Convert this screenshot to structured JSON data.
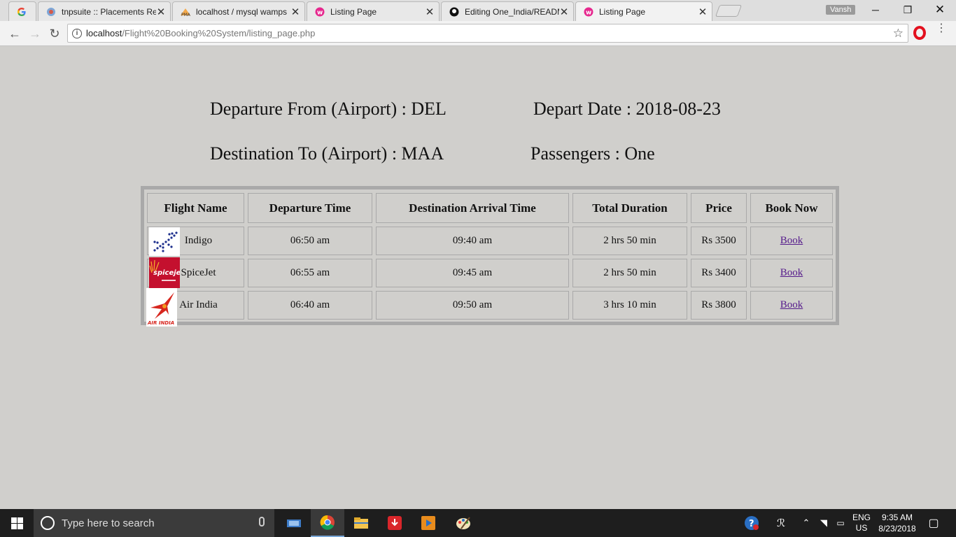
{
  "browser": {
    "tabs": [
      {
        "title": "",
        "icon": "google-icon",
        "active": false
      },
      {
        "title": "tnpsuite :: Placements Re",
        "icon": "tnpsuite-icon",
        "active": false
      },
      {
        "title": "localhost / mysql wamps",
        "icon": "phpmyadmin-icon",
        "active": false
      },
      {
        "title": "Listing Page",
        "icon": "wamp-icon",
        "active": false
      },
      {
        "title": "Editing One_India/READM",
        "icon": "github-icon",
        "active": false
      },
      {
        "title": "Listing Page",
        "icon": "wamp-icon",
        "active": true
      }
    ],
    "profile_name": "Vansh",
    "url_host": "localhost",
    "url_path": "/Flight%20Booking%20System/listing_page.php"
  },
  "search": {
    "departure_line": "Departure From (Airport) : DEL",
    "depart_date_line": "Depart Date : 2018-08-23",
    "destination_line": "Destination To (Airport) : MAA",
    "passengers_line": "Passengers : One"
  },
  "table": {
    "headers": [
      "Flight Name",
      "Departure Time",
      "Destination Arrival Time",
      "Total Duration",
      "Price",
      "Book Now"
    ],
    "rows": [
      {
        "name": "Indigo",
        "logo": "indigo-logo",
        "departure": "06:50 am",
        "arrival": "09:40 am",
        "duration": "2 hrs 50 min",
        "price": "Rs 3500",
        "book": "Book"
      },
      {
        "name": "SpiceJet",
        "logo": "spicejet-logo",
        "departure": "06:55 am",
        "arrival": "09:45 am",
        "duration": "2 hrs 50 min",
        "price": "Rs 3400",
        "book": "Book"
      },
      {
        "name": "Air India",
        "logo": "airindia-logo",
        "departure": "06:40 am",
        "arrival": "09:50 am",
        "duration": "3 hrs 10 min",
        "price": "Rs 3800",
        "book": "Book"
      }
    ]
  },
  "logos": {
    "spicejet_text": "spicejet",
    "airindia_text": "AIR INDIA"
  },
  "taskbar": {
    "search_placeholder": "Type here to search",
    "lang_top": "ENG",
    "lang_bottom": "US",
    "time": "9:35 AM",
    "date": "8/23/2018"
  },
  "colors": {
    "page_bg": "#d0cfcc",
    "table_border": "#a9a9a9",
    "link": "#551a8b",
    "spicejet_red": "#c4102e",
    "airindia_red": "#d7261e",
    "indigo_blue": "#1d2f8c"
  }
}
